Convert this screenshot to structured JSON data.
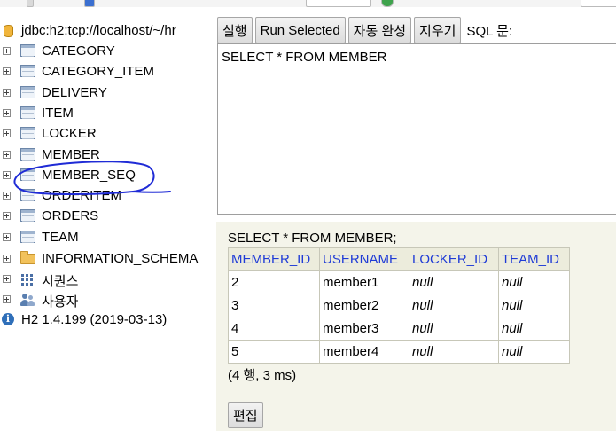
{
  "tree": {
    "connection": "jdbc:h2:tcp://localhost/~/hr",
    "tables": [
      "CATEGORY",
      "CATEGORY_ITEM",
      "DELIVERY",
      "ITEM",
      "LOCKER",
      "MEMBER",
      "MEMBER_SEQ",
      "ORDERITEM",
      "ORDERS",
      "TEAM"
    ],
    "schema": "INFORMATION_SCHEMA",
    "sequences": "시퀀스",
    "users": "사용자",
    "version": "H2 1.4.199 (2019-03-13)"
  },
  "toolbar": {
    "run": "실행",
    "run_selected": "Run Selected",
    "autocomplete": "자동 완성",
    "clear": "지우기",
    "sql_label": "SQL 문:"
  },
  "editor": {
    "sql": "SELECT * FROM MEMBER"
  },
  "result": {
    "statement": "SELECT * FROM MEMBER;",
    "columns": [
      "MEMBER_ID",
      "USERNAME",
      "LOCKER_ID",
      "TEAM_ID"
    ],
    "rows": [
      [
        "2",
        "member1",
        "null",
        "null"
      ],
      [
        "3",
        "member2",
        "null",
        "null"
      ],
      [
        "4",
        "member3",
        "null",
        "null"
      ],
      [
        "5",
        "member4",
        "null",
        "null"
      ]
    ],
    "count": "(4 행, 3 ms)",
    "edit": "편집"
  },
  "annotation": {
    "color": "#1f2bd6"
  }
}
